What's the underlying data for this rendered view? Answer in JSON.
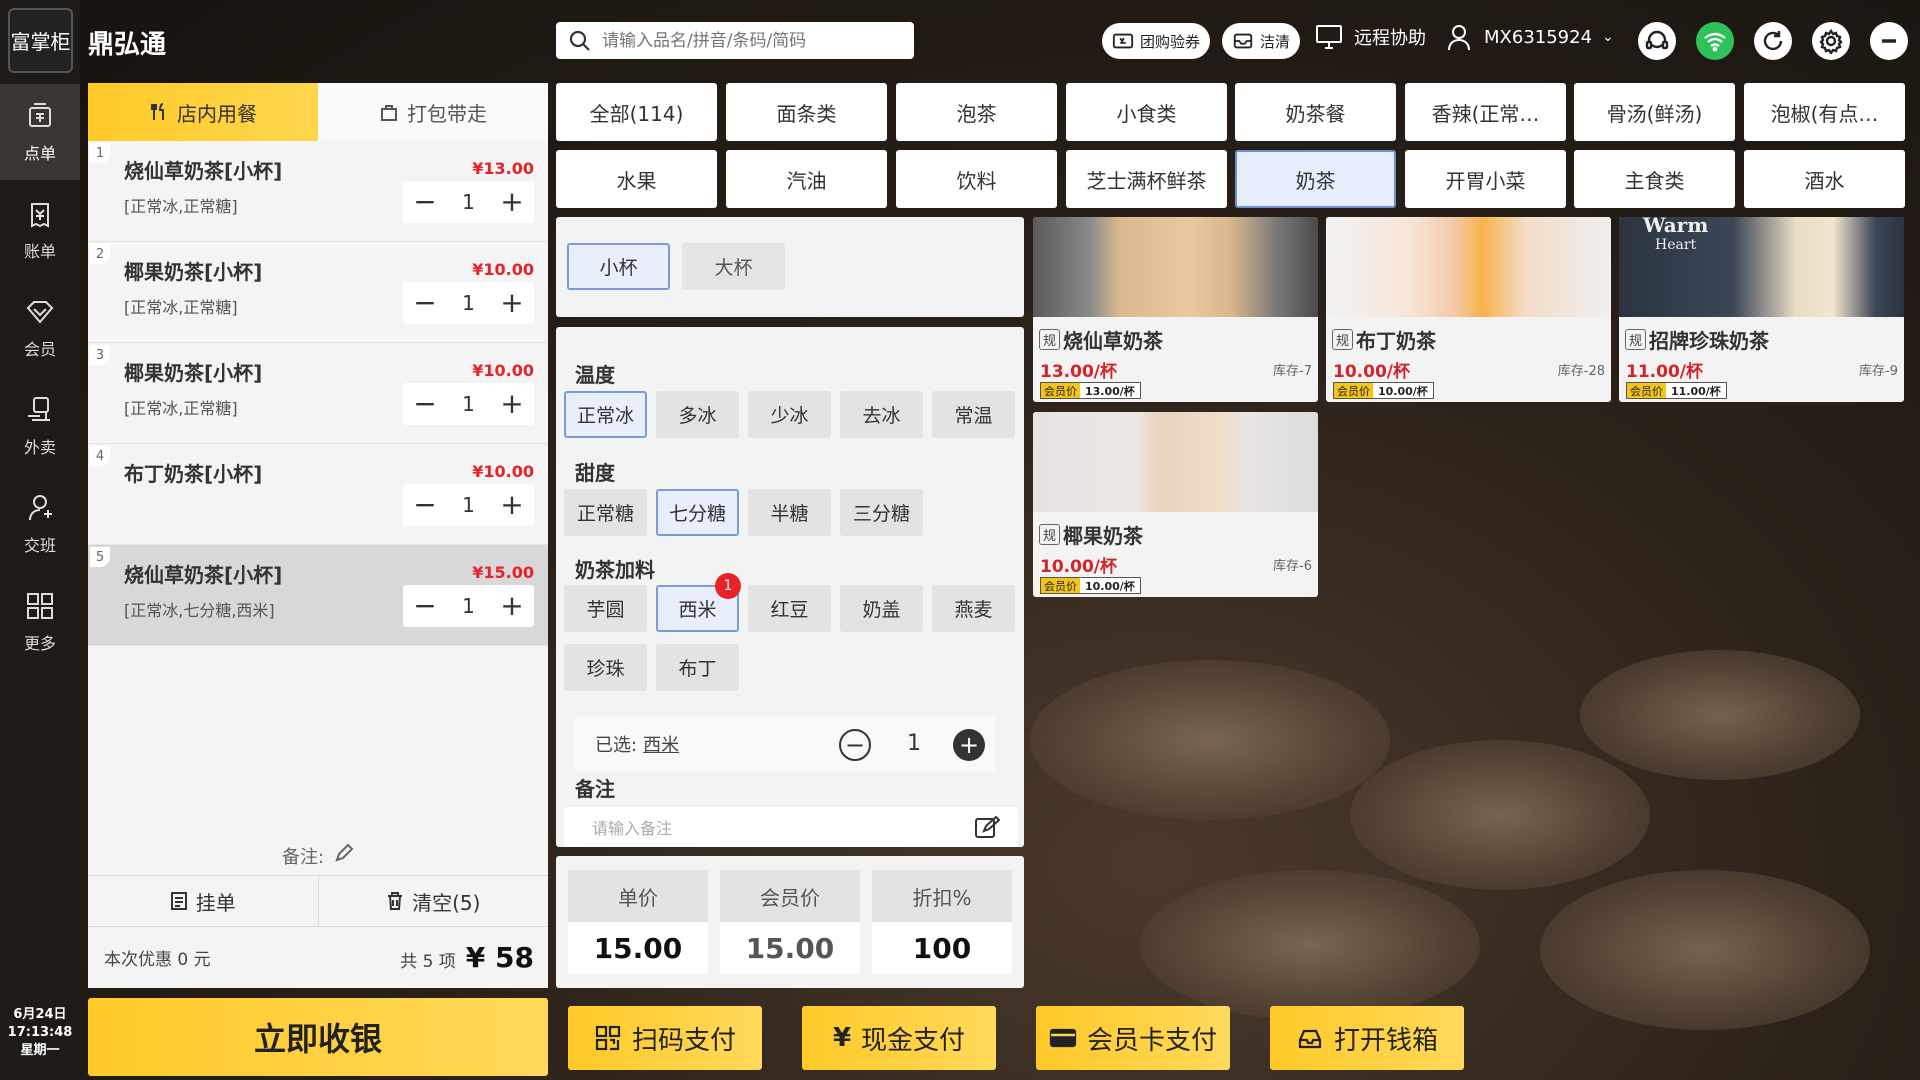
{
  "app": {
    "logo_text": "富掌柜",
    "brand": "鼎弘通",
    "datetime": [
      "6月24日",
      "17:13:48",
      "星期一"
    ]
  },
  "rail": [
    {
      "label": "点单",
      "icon": "order-icon"
    },
    {
      "label": "账单",
      "icon": "bill-icon"
    },
    {
      "label": "会员",
      "icon": "member-icon"
    },
    {
      "label": "外卖",
      "icon": "delivery-icon"
    },
    {
      "label": "交班",
      "icon": "handover-icon"
    },
    {
      "label": "更多",
      "icon": "more-icon"
    }
  ],
  "topbar": {
    "search_placeholder": "请输入品名/拼音/条码/简码",
    "group_buy": "团购验券",
    "clean": "洁清",
    "remote": "远程协助",
    "account": "MX6315924"
  },
  "order": {
    "tab_dine_in": "店内用餐",
    "tab_takeaway": "打包带走",
    "items": [
      {
        "idx": "1",
        "name": "烧仙草奶茶[小杯]",
        "price": "¥13.00",
        "spec": "[正常冰,正常糖]",
        "qty": "1"
      },
      {
        "idx": "2",
        "name": "椰果奶茶[小杯]",
        "price": "¥10.00",
        "spec": "[正常冰,正常糖]",
        "qty": "1"
      },
      {
        "idx": "3",
        "name": "椰果奶茶[小杯]",
        "price": "¥10.00",
        "spec": "[正常冰,正常糖]",
        "qty": "1"
      },
      {
        "idx": "4",
        "name": "布丁奶茶[小杯]",
        "price": "¥10.00",
        "spec": "",
        "qty": "1"
      },
      {
        "idx": "5",
        "name": "烧仙草奶茶[小杯]",
        "price": "¥15.00",
        "spec": "[正常冰,七分糖,西米]",
        "qty": "1"
      }
    ],
    "note_label": "备注:",
    "hold": "挂单",
    "clear": "清空(5)",
    "discount": "本次优惠 0 元",
    "count": "共 5 项",
    "total": "¥ 58",
    "checkout": "立即收银"
  },
  "categories": [
    "全部(114)",
    "面条类",
    "泡茶",
    "小食类",
    "奶茶餐",
    "香辣(正常…",
    "骨汤(鲜汤)",
    "泡椒(有点…",
    "水果",
    "汽油",
    "饮料",
    "芝士满杯鲜茶",
    "奶茶",
    "开胃小菜",
    "主食类",
    "酒水"
  ],
  "spec": {
    "sizes": [
      "小杯",
      "大杯"
    ],
    "temp_label": "温度",
    "temps": [
      "正常冰",
      "多冰",
      "少冰",
      "去冰",
      "常温"
    ],
    "sweet_label": "甜度",
    "sweets": [
      "正常糖",
      "七分糖",
      "半糖",
      "三分糖"
    ],
    "topping_label": "奶茶加料",
    "toppings": [
      "芋圆",
      "西米",
      "红豆",
      "奶盖",
      "燕麦",
      "珍珠",
      "布丁"
    ],
    "topping_badge": "1",
    "selected_label": "已选:",
    "selected_value": "西米",
    "qty": "1",
    "note_label": "备注",
    "note_placeholder": "请输入备注"
  },
  "prices": {
    "unit_label": "单价",
    "unit": "15.00",
    "member_label": "会员价",
    "member": "15.00",
    "discount_label": "折扣%",
    "discount": "100"
  },
  "products": [
    {
      "tag": "规",
      "name": "烧仙草奶茶",
      "price": "13.00/杯",
      "stock": "库存-7",
      "member_label": "会员价",
      "member": "13.00/杯"
    },
    {
      "tag": "规",
      "name": "布丁奶茶",
      "price": "10.00/杯",
      "stock": "库存-28",
      "member_label": "会员价",
      "member": "10.00/杯"
    },
    {
      "tag": "规",
      "name": "招牌珍珠奶茶",
      "price": "11.00/杯",
      "stock": "库存-9",
      "member_label": "会员价",
      "member": "11.00/杯"
    },
    {
      "tag": "规",
      "name": "椰果奶茶",
      "price": "10.00/杯",
      "stock": "库存-6",
      "member_label": "会员价",
      "member": "10.00/杯"
    }
  ],
  "product_image_text": {
    "warm": "Warm",
    "heart": "Heart"
  },
  "pay": {
    "scan": "扫码支付",
    "cash": "现金支付",
    "card": "会员卡支付",
    "drawer": "打开钱箱"
  },
  "colors": {
    "accent": "#ffc928",
    "price_red": "#e8222a",
    "select_blue": "#7a9ad9"
  }
}
